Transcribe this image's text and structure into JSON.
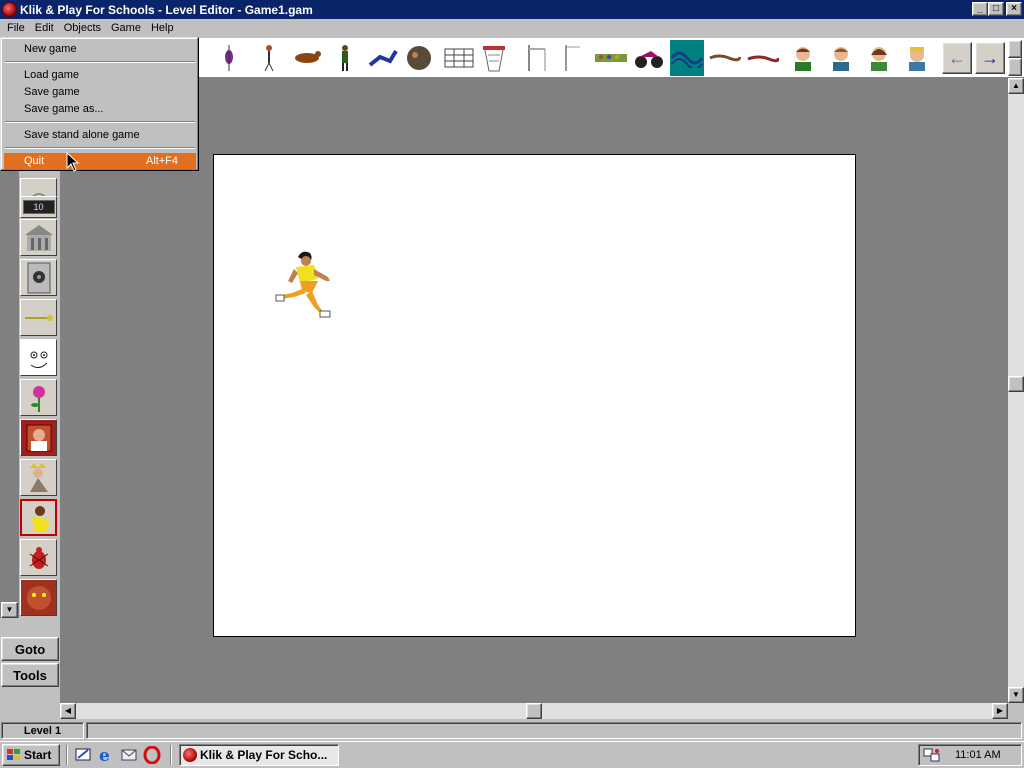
{
  "window": {
    "title": "Klik & Play For Schools - Level Editor - Game1.gam",
    "controls": {
      "minimize": "_",
      "maximize": "□",
      "close": "×"
    }
  },
  "menubar": {
    "items": [
      {
        "label": "File"
      },
      {
        "label": "Edit"
      },
      {
        "label": "Objects"
      },
      {
        "label": "Game"
      },
      {
        "label": "Help"
      }
    ]
  },
  "file_menu": {
    "items": [
      {
        "label": "New game"
      },
      {
        "label": "Load game"
      },
      {
        "label": "Save game"
      },
      {
        "label": "Save game as..."
      },
      {
        "label": "Save stand alone game"
      },
      {
        "label": "Quit",
        "shortcut": "Alt+F4",
        "highlighted": true
      }
    ]
  },
  "toolbar": {
    "objects": [
      "dart-figure-icon",
      "pogo-figure-icon",
      "runner-figure-icon",
      "horse-rider-icon",
      "warrior-figure-icon",
      "diver-figure-icon",
      "barrel-icon",
      "fence-icon",
      "basketball-hoop-icon",
      "hurdle-icon",
      "goalpost-icon",
      "crowd-icon",
      "motorbike-icon",
      "wave-icon",
      "brush-stroke-icon",
      "brush-stroke-alt-icon",
      "boy-face-icon",
      "man-face-icon",
      "girl-face-icon",
      "worker-face-icon"
    ],
    "selected_index": 13,
    "nav": {
      "left": "←",
      "right": "→"
    }
  },
  "palette": {
    "items": [
      "scoreboard-icon",
      "counter-10-icon",
      "building-icon",
      "speaker-icon",
      "key-icon",
      "face-icon",
      "flower-icon",
      "portrait-icon",
      "king-icon",
      "runner-portrait-icon",
      "beetle-icon",
      "monster-icon"
    ],
    "counter_text": "10",
    "selected_index": 9
  },
  "side_buttons": {
    "goto": "Goto",
    "tools": "Tools"
  },
  "status": {
    "level": "Level 1"
  },
  "taskbar": {
    "start": "Start",
    "task": "Klik & Play For Scho...",
    "clock": "11:01 AM"
  },
  "colors": {
    "title_bar": "#0a246a",
    "menu_highlight": "#e07020",
    "workspace": "#808080",
    "selection": "#008080"
  }
}
